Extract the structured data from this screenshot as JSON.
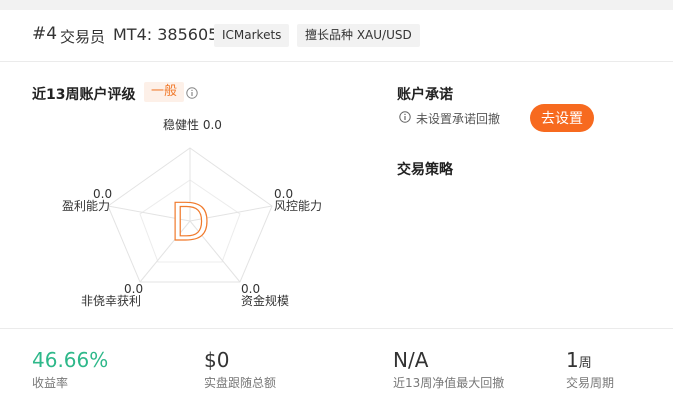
{
  "header": {
    "trader_id": "#4",
    "trader_label": "交易员",
    "account": "MT4: 385605",
    "broker_tag": "ICMarkets",
    "symbol_tag": "擅长品种 XAU/USD"
  },
  "rating": {
    "title": "近13周账户评级",
    "level": "一般",
    "grade": "D",
    "metrics": {
      "stability": {
        "label": "稳健性",
        "value": "0.0"
      },
      "profit": {
        "label": "盈利能力",
        "value": "0.0"
      },
      "risk": {
        "label": "风控能力",
        "value": "0.0"
      },
      "luck": {
        "label": "非侥幸获利",
        "value": "0.0"
      },
      "capital": {
        "label": "资金规模",
        "value": "0.0"
      }
    },
    "accent_color": "#f07a2c"
  },
  "commitment": {
    "title": "账户承诺",
    "status": "未设置承诺回撤",
    "button": "去设置"
  },
  "strategy": {
    "title": "交易策略"
  },
  "stats": {
    "return": {
      "value": "46.66%",
      "label": "收益率"
    },
    "follow": {
      "value": "$0",
      "label": "实盘跟随总额"
    },
    "drawdown": {
      "value": "N/A",
      "label": "近13周净值最大回撤"
    },
    "period": {
      "value": "1",
      "unit": "周",
      "label": "交易周期"
    }
  }
}
